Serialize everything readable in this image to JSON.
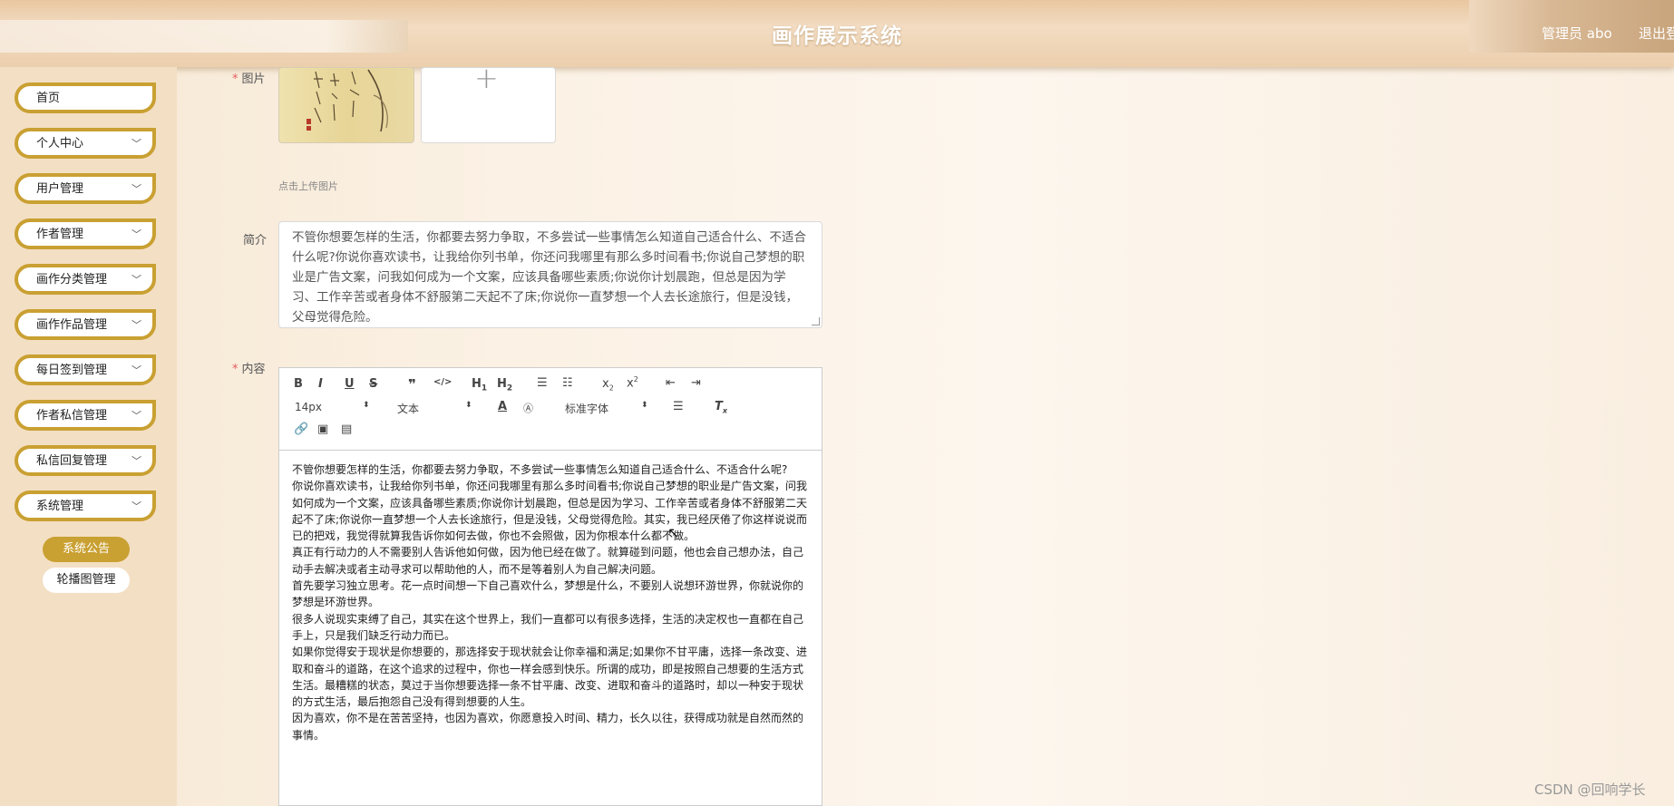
{
  "header": {
    "title": "画作展示系统",
    "user": "管理员 abo",
    "logout": "退出登"
  },
  "sidebar": {
    "items": [
      {
        "label": "首页",
        "has_chevron": false
      },
      {
        "label": "个人中心",
        "has_chevron": true
      },
      {
        "label": "用户管理",
        "has_chevron": true
      },
      {
        "label": "作者管理",
        "has_chevron": true
      },
      {
        "label": "画作分类管理",
        "has_chevron": true
      },
      {
        "label": "画作作品管理",
        "has_chevron": true
      },
      {
        "label": "每日签到管理",
        "has_chevron": true
      },
      {
        "label": "作者私信管理",
        "has_chevron": true
      },
      {
        "label": "私信回复管理",
        "has_chevron": true
      },
      {
        "label": "系统管理",
        "has_chevron": true
      }
    ],
    "subitems": [
      {
        "label": "系统公告",
        "active": true
      },
      {
        "label": "轮播图管理",
        "active": false
      }
    ],
    "accent_color": "#c9a032"
  },
  "form": {
    "image_label": "图片",
    "upload_tip": "点击上传图片",
    "upload_icon": "plus-icon",
    "intro_label": "简介",
    "intro_text": "不管你想要怎样的生活，你都要去努力争取，不多尝试一些事情怎么知道自己适合什么、不适合什么呢?你说你喜欢读书，让我给你列书单，你还问我哪里有那么多时间看书;你说自己梦想的职业是广告文案，问我如何成为一个文案，应该具备哪些素质;你说你计划晨跑，但总是因为学习、工作辛苦或者身体不舒服第二天起不了床;你说你一直梦想一个人去长途旅行，但是没钱，父母觉得危险。",
    "content_label": "内容"
  },
  "editor": {
    "toolbar_row1": [
      "B",
      "I",
      "U",
      "S",
      "❞",
      "</>",
      "H1",
      "H2",
      "ol",
      "ul",
      "x₂",
      "x²",
      "outdent",
      "indent"
    ],
    "font_size": "14px",
    "text_style": "文本",
    "font_family": "标准字体",
    "paragraphs": [
      "不管你想要怎样的生活，你都要去努力争取，不多尝试一些事情怎么知道自己适合什么、不适合什么呢?",
      "你说你喜欢读书，让我给你列书单，你还问我哪里有那么多时间看书;你说自己梦想的职业是广告文案，问我如何成为一个文案，应该具备哪些素质;你说你计划晨跑，但总是因为学习、工作辛苦或者身体不舒服第二天起不了床;你说你一直梦想一个人去长途旅行，但是没钱，父母觉得危险。其实，我已经厌倦了你这样说说而已的把戏，我觉得就算我告诉你如何去做，你也不会照做，因为你根本什么都不做。",
      "真正有行动力的人不需要别人告诉他如何做，因为他已经在做了。就算碰到问题，他也会自己想办法，自己动手去解决或者主动寻求可以帮助他的人，而不是等着别人为自己解决问题。",
      "首先要学习独立思考。花一点时间想一下自己喜欢什么，梦想是什么，不要别人说想环游世界，你就说你的梦想是环游世界。",
      "很多人说现实束缚了自己，其实在这个世界上，我们一直都可以有很多选择，生活的决定权也一直都在自己手上，只是我们缺乏行动力而已。",
      "如果你觉得安于现状是你想要的，那选择安于现状就会让你幸福和满足;如果你不甘平庸，选择一条改变、进取和奋斗的道路，在这个追求的过程中，你也一样会感到快乐。所谓的成功，即是按照自己想要的生活方式生活。最糟糕的状态，莫过于当你想要选择一条不甘平庸、改变、进取和奋斗的道路时，却以一种安于现状的方式生活，最后抱怨自己没有得到想要的人生。",
      "因为喜欢，你不是在苦苦坚持，也因为喜欢，你愿意投入时间、精力，长久以往，获得成功就是自然而然的事情。"
    ]
  },
  "watermark": "CSDN @回响学长"
}
